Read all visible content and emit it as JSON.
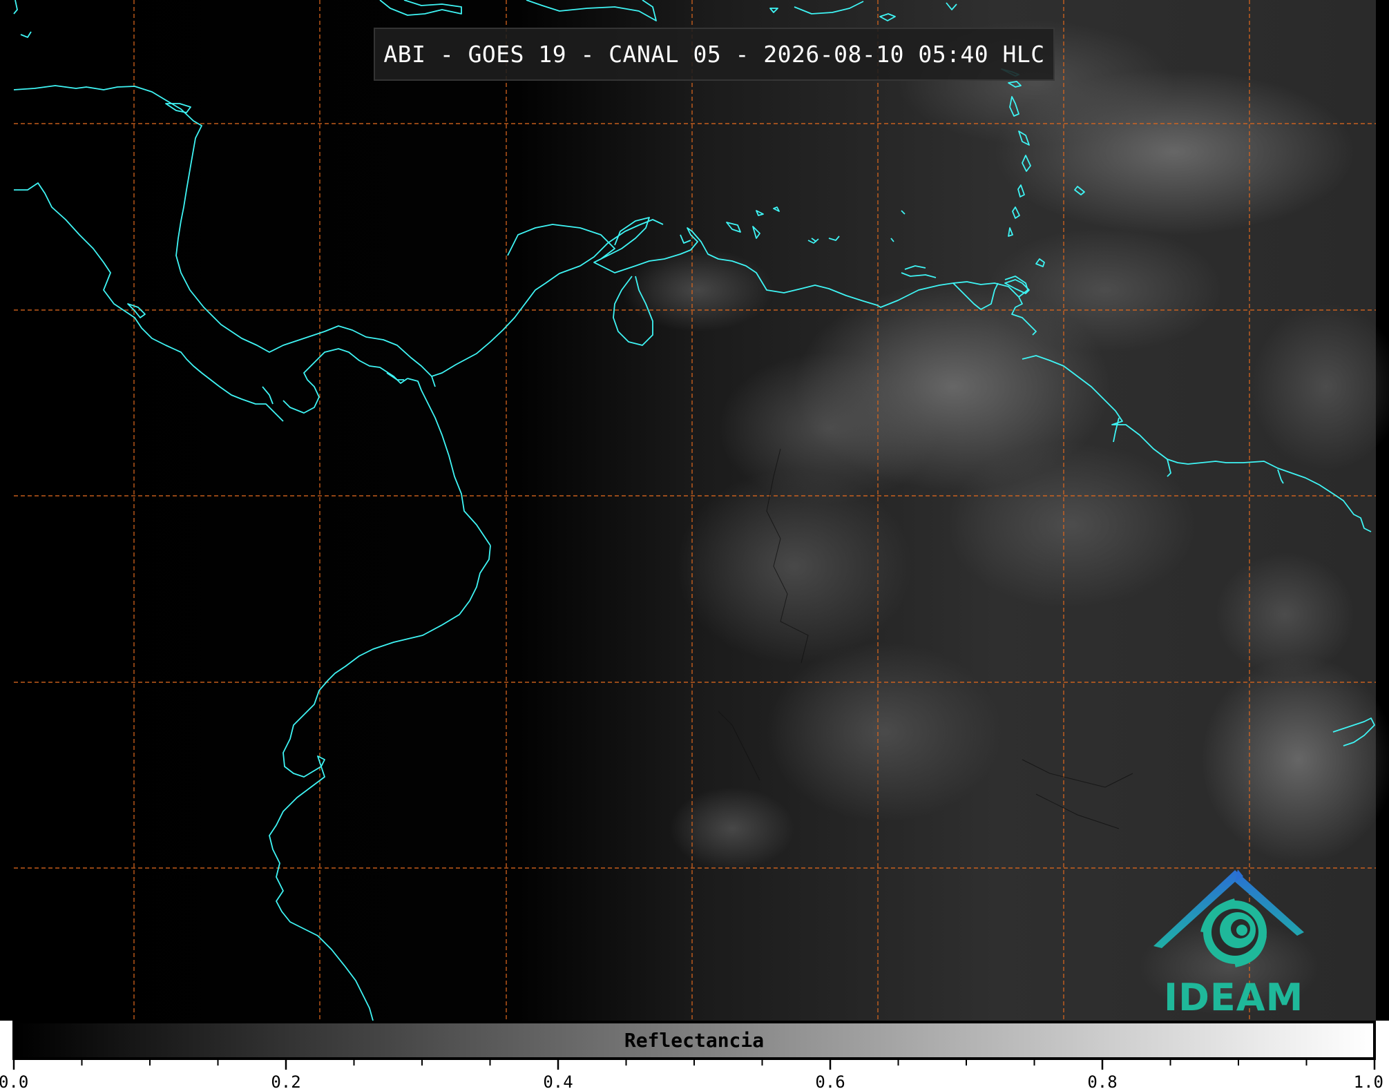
{
  "title": "ABI - GOES 19 - CANAL 05 - 2026-08-10 05:40 HLC",
  "colorbar": {
    "label": "Reflectancia",
    "range": [
      0.0,
      1.0
    ],
    "major_ticks": [
      "0.0",
      "0.2",
      "0.4",
      "0.6",
      "0.8",
      "1.0"
    ],
    "minor_step": 0.05,
    "gradient_from": "#000000",
    "gradient_to": "#ffffff"
  },
  "logo": {
    "text": "IDEAM",
    "colors": {
      "arch": "#2a7fd4",
      "swirl": "#1fb89a"
    }
  },
  "map": {
    "coastline_color": "#3ff5f5",
    "grid_color": "#d9661e",
    "grid": "dashed",
    "background": "#000000"
  }
}
